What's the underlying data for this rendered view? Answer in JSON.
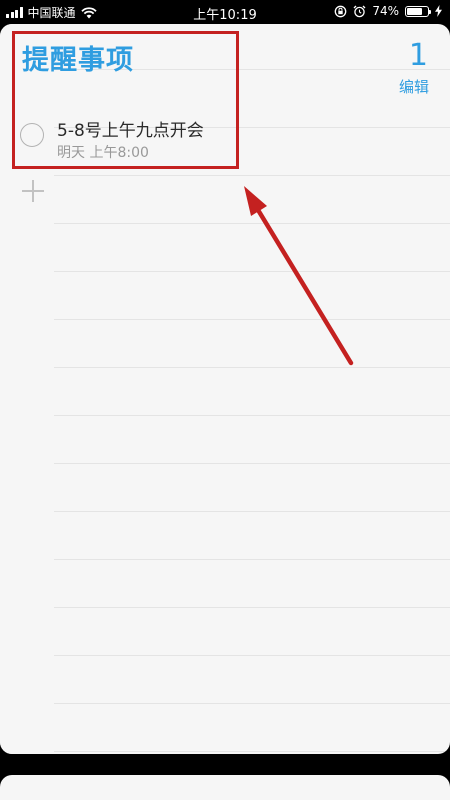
{
  "status_bar": {
    "carrier": "中国联通",
    "time": "上午10:19",
    "battery": "74%",
    "battery_level": 0.74
  },
  "list": {
    "title": "提醒事项",
    "count": "1",
    "edit_label": "编辑"
  },
  "reminders": [
    {
      "title": "5-8号上午九点开会",
      "due": "明天 上午8:00"
    }
  ],
  "colors": {
    "accent": "#2f9de0",
    "annotation": "#c42120"
  },
  "icons": [
    "signal-icon",
    "wifi-icon",
    "rotation-lock-icon",
    "alarm-icon",
    "battery-icon",
    "charging-icon",
    "check-circle-icon",
    "plus-icon"
  ]
}
